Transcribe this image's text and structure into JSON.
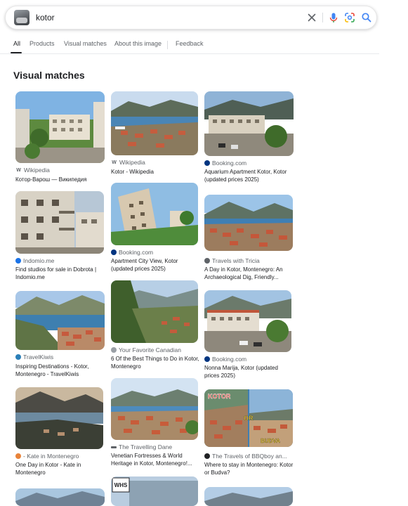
{
  "search": {
    "query": "kotor"
  },
  "colors": {
    "google_blue": "#4285f4",
    "google_red": "#ea4335",
    "google_yellow": "#fbbc05",
    "google_green": "#34a853"
  },
  "tabs": [
    {
      "label": "All",
      "active": true
    },
    {
      "label": "Products"
    },
    {
      "label": "Visual matches"
    },
    {
      "label": "About this image"
    },
    {
      "label": "Feedback"
    }
  ],
  "section_title": "Visual matches",
  "results": [
    {
      "source": "Wikipedia",
      "title": "Котор-Варош — Википедия",
      "icon": "wikipedia-icon"
    },
    {
      "source": "Wikipedia",
      "title": "Kotor - Wikipedia",
      "icon": "wikipedia-icon"
    },
    {
      "source": "Booking.com",
      "title": "Aquarium Apartment Kotor, Kotor (updated prices 2025)",
      "icon": "booking-icon"
    },
    {
      "source": "Indomio.me",
      "title": "Find studios for sale in Dobrota | Indomio.me",
      "icon": "indomio-icon"
    },
    {
      "source": "Booking.com",
      "title": "Apartment City View, Kotor (updated prices 2025)",
      "icon": "booking-icon"
    },
    {
      "source": "Travels with Tricia",
      "title": "A Day in Kotor, Montenegro: An Archaeological Dig, Friendly...",
      "icon": "travels-with-tricia-icon"
    },
    {
      "source": "TravelKiwis",
      "title": "Inspiring Destinations - Kotor, Montenegro - TravelKiwis",
      "icon": "travelkiwis-icon"
    },
    {
      "source": "Your Favorite Canadian",
      "title": "6 Of the Best Things to Do in Kotor, Montenegro",
      "icon": "your-favorite-canadian-icon"
    },
    {
      "source": "Booking.com",
      "title": "Nonna Marija, Kotor (updated prices 2025)",
      "icon": "booking-icon"
    },
    {
      "source": "- Kate in Montenegro",
      "title": "One Day in Kotor - Kate in Montenegro",
      "icon": "kate-in-montenegro-icon"
    },
    {
      "source": "The Travelling Dane",
      "title": "Venetian Fortresses & World Heritage in Kotor, Montenegro!...",
      "icon": "travelling-dane-icon"
    },
    {
      "source": "The Travels of BBQboy an...",
      "title": "Where to stay in Montenegro: Kotor or Budva?",
      "icon": "bbqboy-icon"
    }
  ],
  "image_labels": {
    "whs": "WHS",
    "kotor": "KOTOR",
    "or": "OR",
    "budva": "BUDVA"
  }
}
